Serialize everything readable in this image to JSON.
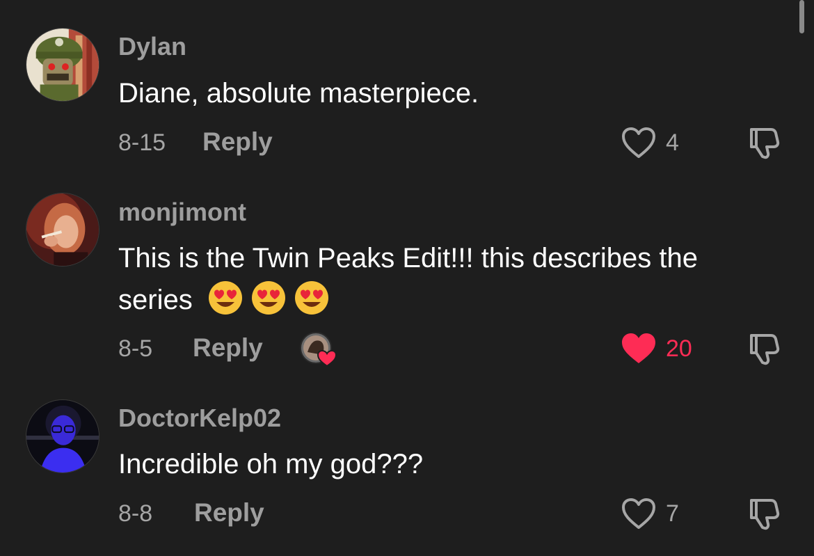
{
  "comments": [
    {
      "username": "Dylan",
      "text": "Diane, absolute masterpiece.",
      "date": "8-15",
      "reply_label": "Reply",
      "likes": "4",
      "liked": false,
      "avatar": "soldier-helmet-avatar"
    },
    {
      "username": "monjimont",
      "text": "This is the Twin Peaks Edit!!! this describes the series",
      "emojis": [
        "heart-eyes-emoji",
        "heart-eyes-emoji",
        "heart-eyes-emoji"
      ],
      "date": "8-5",
      "reply_label": "Reply",
      "likes": "20",
      "liked": true,
      "creator_liked": true,
      "avatar": "woman-smoking-red-avatar"
    },
    {
      "username": "DoctorKelp02",
      "text": "Incredible oh my god???",
      "date": "8-8",
      "reply_label": "Reply",
      "likes": "7",
      "liked": false,
      "avatar": "blue-glasses-avatar"
    }
  ],
  "colors": {
    "background": "#1e1e1e",
    "username": "#9e9e9e",
    "text": "#ffffff",
    "meta": "#a6a6a6",
    "like_active": "#fe2c55"
  }
}
